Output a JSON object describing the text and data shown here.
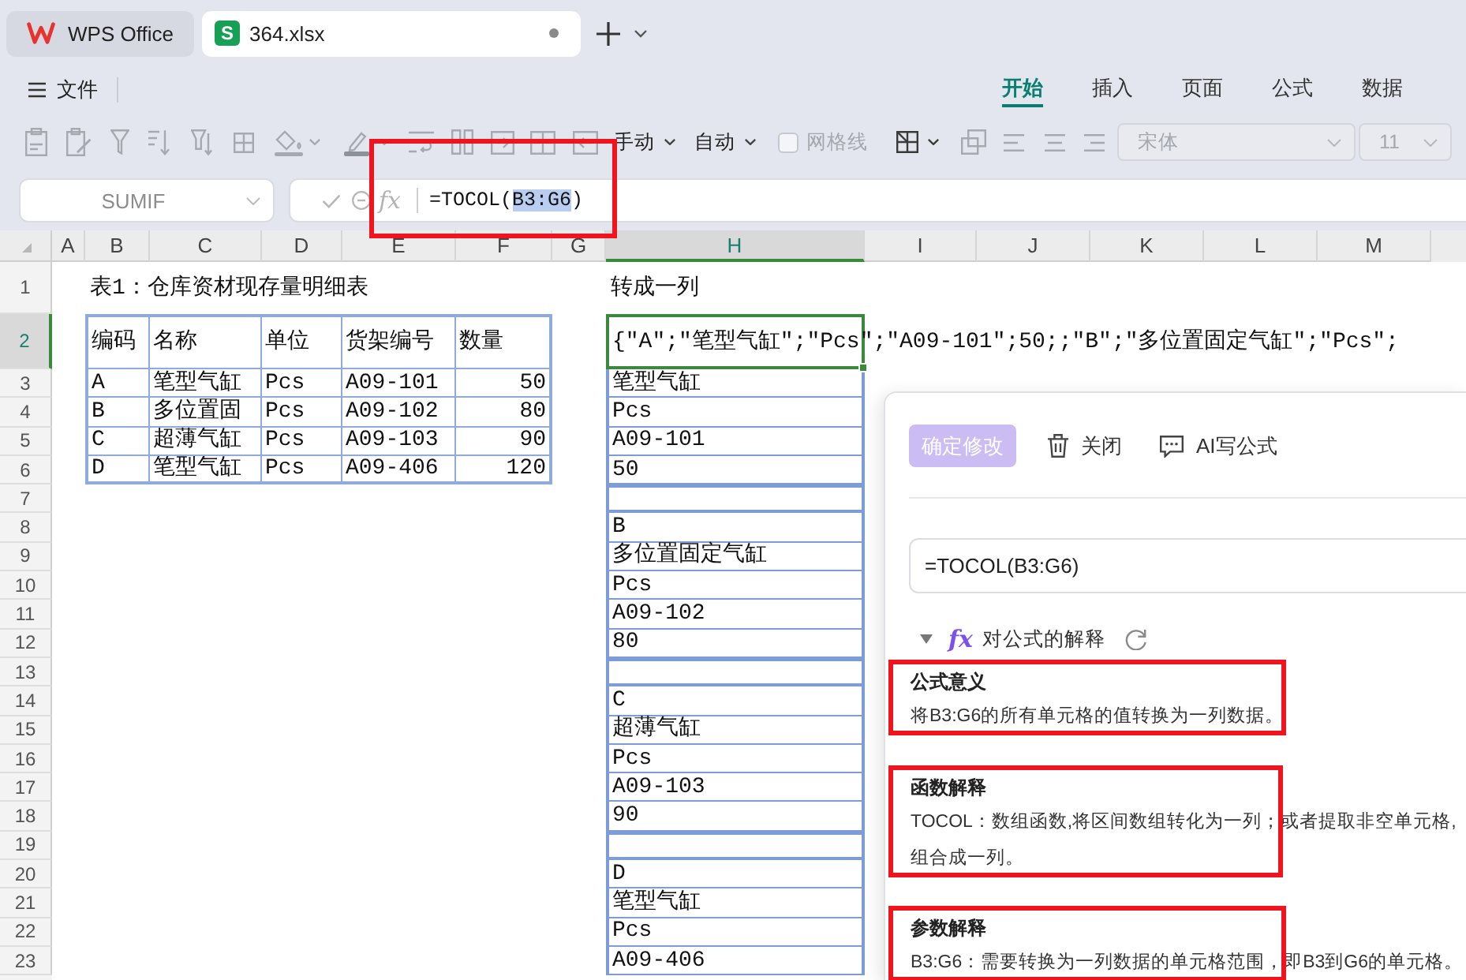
{
  "tabs": [
    {
      "kind": "home",
      "label": "WPS Office",
      "selected": false,
      "modified": false
    },
    {
      "kind": "document",
      "icon_text": "S",
      "label": "364.xlsx",
      "selected": true,
      "modified": true
    }
  ],
  "menu": {
    "label": "文件"
  },
  "ribbon_tabs": [
    {
      "label": "开始",
      "selected": true
    },
    {
      "label": "插入",
      "selected": false
    },
    {
      "label": "页面",
      "selected": false
    },
    {
      "label": "公式",
      "selected": false
    },
    {
      "label": "数据",
      "selected": false
    }
  ],
  "toolbar": {
    "calc_modes": [
      "手动",
      "自动"
    ],
    "gridlines": {
      "label": "网格线",
      "checked": false,
      "disabled": true
    },
    "font": {
      "value": "宋体",
      "disabled": true
    },
    "font_size": {
      "value": "11",
      "disabled": true
    }
  },
  "formula_bar": {
    "name_box": "SUMIF",
    "function_button": "fx",
    "formula": [
      {
        "text": "=TOCOL(",
        "selected": false
      },
      {
        "text": "B3:G6",
        "selected": true
      },
      {
        "text": ")",
        "selected": false
      }
    ],
    "highlighted": true
  },
  "sheet": {
    "columns": [
      {
        "label": "A",
        "selected": false
      },
      {
        "label": "B",
        "selected": false
      },
      {
        "label": "C",
        "selected": false
      },
      {
        "label": "D",
        "selected": false
      },
      {
        "label": "E",
        "selected": false
      },
      {
        "label": "F",
        "selected": false
      },
      {
        "label": "G",
        "selected": false
      },
      {
        "label": "H",
        "selected": true
      },
      {
        "label": "I",
        "selected": false
      },
      {
        "label": "J",
        "selected": false
      },
      {
        "label": "K",
        "selected": false
      },
      {
        "label": "L",
        "selected": false
      },
      {
        "label": "M",
        "selected": false
      }
    ],
    "rows": [
      {
        "label": "1",
        "selected": false
      },
      {
        "label": "2",
        "selected": true
      },
      {
        "label": "3",
        "selected": false
      },
      {
        "label": "4",
        "selected": false
      },
      {
        "label": "5",
        "selected": false
      },
      {
        "label": "6",
        "selected": false
      },
      {
        "label": "7",
        "selected": false
      },
      {
        "label": "8",
        "selected": false
      },
      {
        "label": "9",
        "selected": false
      },
      {
        "label": "10",
        "selected": false
      },
      {
        "label": "11",
        "selected": false
      },
      {
        "label": "12",
        "selected": false
      },
      {
        "label": "13",
        "selected": false
      },
      {
        "label": "14",
        "selected": false
      },
      {
        "label": "15",
        "selected": false
      },
      {
        "label": "16",
        "selected": false
      },
      {
        "label": "17",
        "selected": false
      },
      {
        "label": "18",
        "selected": false
      },
      {
        "label": "19",
        "selected": false
      },
      {
        "label": "20",
        "selected": false
      },
      {
        "label": "21",
        "selected": false
      },
      {
        "label": "22",
        "selected": false
      },
      {
        "label": "23",
        "selected": false
      }
    ],
    "inventory": {
      "title": "表1：仓库资材现存量明细表",
      "columns": [
        "编码",
        "名称",
        "单位",
        "货架编号",
        "数量"
      ],
      "rows": [
        [
          "A",
          "笔型气缸",
          "Pcs",
          "A09-101",
          "50"
        ],
        [
          "B",
          "多位置固",
          "Pcs",
          "A09-102",
          "80"
        ],
        [
          "C",
          "超薄气缸",
          "Pcs",
          "A09-103",
          "90"
        ],
        [
          "D",
          "笔型气缸",
          "Pcs",
          "A09-406",
          "120"
        ]
      ]
    },
    "output": {
      "title": "转成一列",
      "formula_result": {
        "text": "{\"A\";\"笔型气缸\";\"Pcs\";\"A09-101\";50;;\"B\";\"多位置固定气缸\";\"Pcs\";",
        "selected": true
      },
      "groups": [
        [
          "笔型气缸",
          "Pcs",
          "A09-101",
          "50"
        ],
        [
          "B",
          "多位置固定气缸",
          "Pcs",
          "A09-102",
          "80"
        ],
        [
          "C",
          "超薄气缸",
          "Pcs",
          "A09-103",
          "90"
        ],
        [
          "D",
          "笔型气缸",
          "Pcs",
          "A09-406"
        ]
      ]
    }
  },
  "formula_panel": {
    "confirm_button": {
      "label": "确定修改",
      "disabled": true
    },
    "close_button": "关闭",
    "ai_button": "AI写公式",
    "formula": "=TOCOL(B3:G6)",
    "explanation": {
      "expanded": true,
      "icon": "fx",
      "title": "对公式的解释",
      "sections": [
        {
          "title": "公式意义",
          "body": "将B3:G6的所有单元格的值转换为一列数据。",
          "highlighted": true
        },
        {
          "title": "函数解释",
          "body": "TOCOL：数组函数,将区间数组转化为一列；或者提取非空单元格,组合成一列。",
          "highlighted": true
        },
        {
          "title": "参数解释",
          "body": "B3:G6：需要转换为一列数据的单元格范围，即B3到G6的单元格。",
          "highlighted": true
        }
      ]
    }
  }
}
